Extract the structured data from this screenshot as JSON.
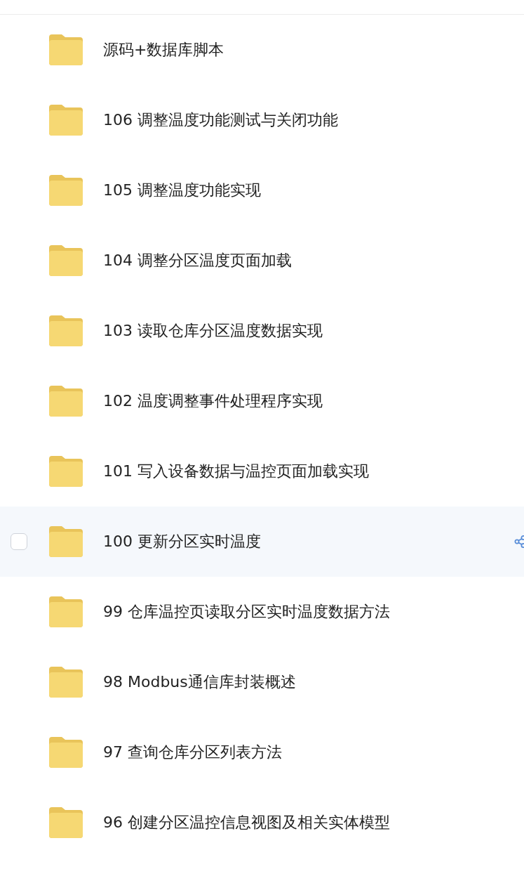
{
  "folders": [
    {
      "name": "源码+数据库脚本",
      "highlighted": false
    },
    {
      "name": "106 调整温度功能测试与关闭功能",
      "highlighted": false
    },
    {
      "name": "105 调整温度功能实现",
      "highlighted": false
    },
    {
      "name": "104 调整分区温度页面加载",
      "highlighted": false
    },
    {
      "name": "103 读取仓库分区温度数据实现",
      "highlighted": false
    },
    {
      "name": "102 温度调整事件处理程序实现",
      "highlighted": false
    },
    {
      "name": "101 写入设备数据与温控页面加载实现",
      "highlighted": false
    },
    {
      "name": "100 更新分区实时温度",
      "highlighted": true,
      "checked": false
    },
    {
      "name": "99 仓库温控页读取分区实时温度数据方法",
      "highlighted": false
    },
    {
      "name": "98 Modbus通信库封装概述",
      "highlighted": false
    },
    {
      "name": "97 查询仓库分区列表方法",
      "highlighted": false
    },
    {
      "name": "96 创建分区温控信息视图及相关实体模型",
      "highlighted": false
    }
  ]
}
